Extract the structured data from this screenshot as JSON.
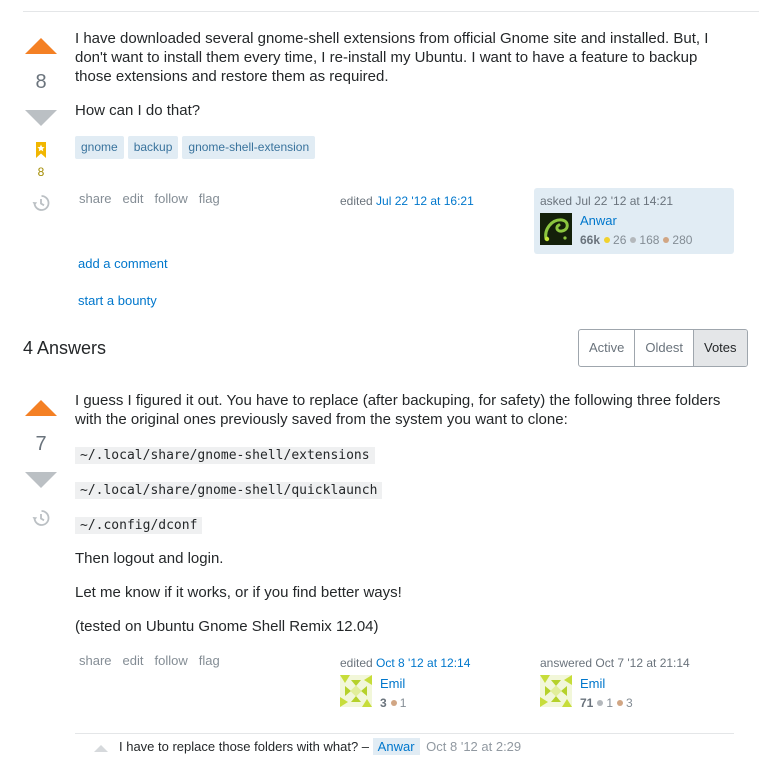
{
  "question": {
    "votes": "8",
    "favorites": "8",
    "body": [
      "I have downloaded several gnome-shell extensions from official Gnome site and installed. But, I don't want to install them every time, I re-install my Ubuntu. I want to have a feature to backup those extensions and restore them as required.",
      "How can I do that?"
    ],
    "tags": [
      "gnome",
      "backup",
      "gnome-shell-extension"
    ],
    "menu": [
      "share",
      "edit",
      "follow",
      "flag"
    ],
    "edited_label": "edited",
    "edited_time": "Jul 22 '12 at 16:21",
    "asked_label": "asked",
    "asked_time": "Jul 22 '12 at 14:21",
    "owner": {
      "name": "Anwar",
      "rep": "66k",
      "gold": "26",
      "silver": "168",
      "bronze": "280"
    },
    "add_comment": "add a comment",
    "start_bounty": "start a bounty"
  },
  "answers_header": {
    "count": "4",
    "label": "Answers",
    "tabs": [
      "Active",
      "Oldest",
      "Votes"
    ]
  },
  "answer": {
    "votes": "7",
    "body_intro": "I guess I figured it out. You have to replace (after backuping, for safety) the following three folders with the original ones previously saved from the system you want to clone:",
    "paths": [
      "~/.local/share/gnome-shell/extensions",
      "~/.local/share/gnome-shell/quicklaunch",
      "~/.config/dconf"
    ],
    "p1": "Then logout and login.",
    "p2": "Let me know if it works, or if you find better ways!",
    "p3": "(tested on Ubuntu Gnome Shell Remix 12.04)",
    "menu": [
      "share",
      "edit",
      "follow",
      "flag"
    ],
    "edited_label": "edited",
    "edited_time": "Oct 8 '12 at 12:14",
    "editor": {
      "name": "Emil",
      "rep": "3",
      "bronze": "1"
    },
    "answered_label": "answered",
    "answered_time": "Oct 7 '12 at 21:14",
    "author": {
      "name": "Emil",
      "rep": "71",
      "silver": "1",
      "bronze": "3"
    }
  },
  "comment": {
    "text": "I have to replace those folders with what? –",
    "user": "Anwar",
    "time": "Oct 8 '12 at 2:29"
  },
  "colors": {
    "upvote_active": "#f48024",
    "vote_inactive": "#bbc0c4",
    "link": "#0077cc",
    "tag_bg": "#e1ecf4"
  },
  "icons": [
    "upvote-arrow",
    "downvote-arrow",
    "bookmark-icon",
    "history-icon",
    "avatar"
  ]
}
